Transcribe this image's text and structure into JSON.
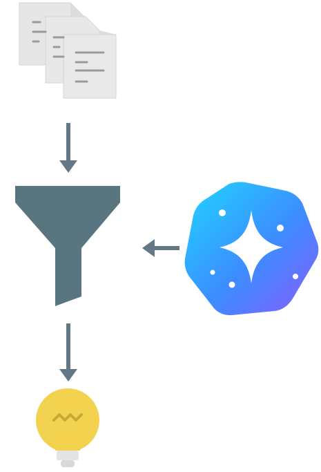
{
  "diagram": {
    "nodes": [
      {
        "id": "documents",
        "icon": "documents-icon"
      },
      {
        "id": "filter",
        "icon": "funnel-icon"
      },
      {
        "id": "ai",
        "icon": "sparkle-badge-icon"
      },
      {
        "id": "insight",
        "icon": "lightbulb-icon"
      }
    ],
    "edges": [
      {
        "from": "documents",
        "to": "filter"
      },
      {
        "from": "ai",
        "to": "filter"
      },
      {
        "from": "filter",
        "to": "insight"
      }
    ],
    "colors": {
      "document_fill": "#e6e6e6",
      "document_edge": "#d2d2d2",
      "document_lines": "#9a9a9a",
      "arrow": "#647785",
      "funnel": "#587580",
      "badge_gradient_start": "#1fd6ff",
      "badge_gradient_mid": "#3d8cff",
      "badge_gradient_end": "#8a5cff",
      "sparkle": "#ffffff",
      "bulb": "#f2d24f",
      "bulb_squiggle": "#c9a935",
      "bulb_base": "#e4e4e4"
    }
  }
}
